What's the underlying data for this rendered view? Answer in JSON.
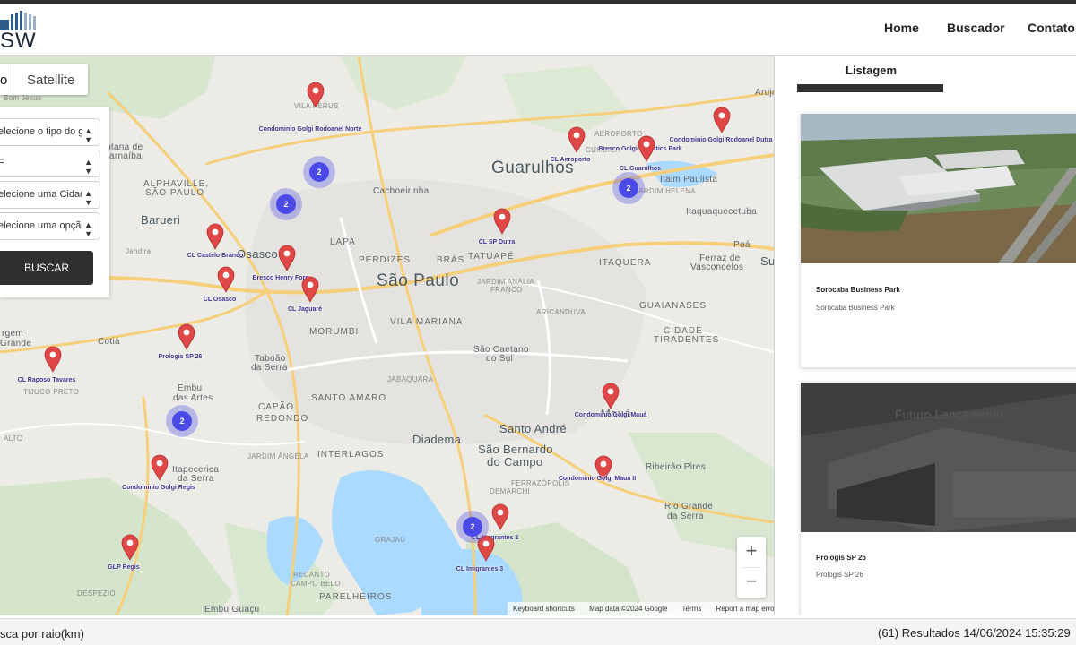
{
  "brand": {
    "logo_text": "SW"
  },
  "nav": {
    "home": "Home",
    "buscador": "Buscador",
    "contato": "Contato"
  },
  "map": {
    "toggle": {
      "map_label": "o",
      "satellite_label": "Satellite"
    },
    "filters": {
      "tipo": "elecione o tipo do ga",
      "uf": "F",
      "cidade": "elecione uma Cidade",
      "opcao": "elecione uma opção",
      "buscar_label": "BUSCAR"
    },
    "labels": {
      "guarulhos": "Guarulhos",
      "sao_paulo": "São Paulo",
      "osasco": "Osasco",
      "barueri": "Barueri",
      "diadema": "Diadema",
      "santo_andre": "Santo André",
      "sao_bernardo": "São Bernardo",
      "do_campo": "do Campo",
      "maua": "Mauá",
      "cachoeirinha": "Cachoeirinha",
      "lapa": "LAPA",
      "perdizes": "PERDIZES",
      "bras": "BRÁS",
      "tatuape": "TATUAPÉ",
      "vila_mariana": "VILA MARIANA",
      "morumbi": "MORUMBI",
      "santo_amaro": "SANTO AMARO",
      "interlagos": "INTERLAGOS",
      "jabaquara": "JABAQUARA",
      "capao_redondo_1": "CAPÃO",
      "capao_redondo_2": "REDONDO",
      "itaquera": "ITAQUERA",
      "guaianases": "GUAIANASES",
      "cidade_tiradentes_1": "CIDADE",
      "cidade_tiradentes_2": "TIRADENTES",
      "cumbica": "CUMBICA",
      "alphaville_1": "ALPHAVILLE,",
      "alphaville_2": "SÃO PAULO",
      "parelheiros": "PARELHEIROS",
      "embu_guacu": "Embu Guaçu",
      "taboao_1": "Taboão",
      "taboao_2": "da Serra",
      "embu_1": "Embu",
      "embu_2": "das Artes",
      "itapecerica_1": "Itapecerica",
      "itapecerica_2": "da Serra",
      "cotia": "Cotia",
      "poa": "Poá",
      "ferraz_1": "Ferraz de",
      "ferraz_2": "Vasconcelos",
      "itaquaquecetuba": "Itaquaquecetuba",
      "itaim_paulista": "Itaim Paulista",
      "sao_caetano_1": "São Caetano",
      "sao_caetano_2": "do Sul",
      "ribeirao_pires": "Ribeirão Pires",
      "rio_grande_1": "Rio Grande",
      "rio_grande_2": "da Serra",
      "bom_jesus": "Bom Jesus",
      "jandira": "Jandira",
      "jardim_angela": "JARDIM ÂNGELA",
      "grajau": "GRAJAÚ",
      "tijuco_preto": "TIJUCO PRETO",
      "vila_perus": "VILA PERUS",
      "aeroporto": "AEROPORTO",
      "jardim_helena": "JARDIM HELENA",
      "ferrazopolis": "FERRAZÓPOLIS",
      "demarchi": "DEMARCHI",
      "aricanduva": "ARICANDUVA",
      "jardim_analia_1": "JARDIM ANÁLIA",
      "jardim_analia_2": "FRANCO",
      "campo_belo_1": "RECANTO",
      "campo_belo_2": "CAMPO BELO",
      "despezio": "DESPEZIO",
      "alto": "ALTO",
      "arujá": "Arujá",
      "suzano": "Su",
      "grande": "Grande",
      "margem": "rgem",
      "fantana": "ntana de",
      "arnaiba": "arnaíba"
    },
    "markers": [
      {
        "label": "Condominio Golgi Rodoanel Norte"
      },
      {
        "label": "CL Aeroporto"
      },
      {
        "label": "Bresco Golgi Logistics Park"
      },
      {
        "label": "CL Guarulhos"
      },
      {
        "label": "Condominio Golgi Rodoanel Dutra"
      },
      {
        "label": "CL SP Dutra"
      },
      {
        "label": "CL Castelo Branco"
      },
      {
        "label": "Bresco Henry Ford"
      },
      {
        "label": "CL Osasco"
      },
      {
        "label": "CL Jaguaré"
      },
      {
        "label": "Prologis SP 26"
      },
      {
        "label": "CL Raposo Tavares"
      },
      {
        "label": "Condominio Golgi Mauá"
      },
      {
        "label": "Condominio Golgi Mauá II"
      },
      {
        "label": "Condominio Golgi Regis"
      },
      {
        "label": "GLP Regis"
      },
      {
        "label": "CL Imigrantes 2"
      },
      {
        "label": "CL Imigrantes 3"
      }
    ],
    "clusters": [
      {
        "count": "2"
      },
      {
        "count": "2"
      },
      {
        "count": "2"
      },
      {
        "count": "2"
      },
      {
        "count": "2"
      }
    ],
    "zoom": {
      "in": "+",
      "out": "−"
    },
    "attribution": {
      "shortcuts": "Keyboard shortcuts",
      "data": "Map data ©2024 Google",
      "terms": "Terms",
      "report": "Report a map error"
    }
  },
  "sidebar": {
    "tab_label": "Listagem",
    "cards": [
      {
        "title": "Sorocaba Business Park",
        "subtitle": "Sorocaba Business Park",
        "overlay": ""
      },
      {
        "title": "Prologis SP 26",
        "subtitle": "Prologis SP 26",
        "overlay": "Futuro Lançamento"
      }
    ]
  },
  "footer": {
    "radius_label": "sca por raio(km)",
    "results": "(61) Resultados",
    "datetime": "14/06/2024 15:35:29"
  },
  "colors": {
    "pin": "#e04848",
    "cluster": "#4a4ae8",
    "dark_bar": "#2f2f2f",
    "map_land": "#ecebe6"
  }
}
